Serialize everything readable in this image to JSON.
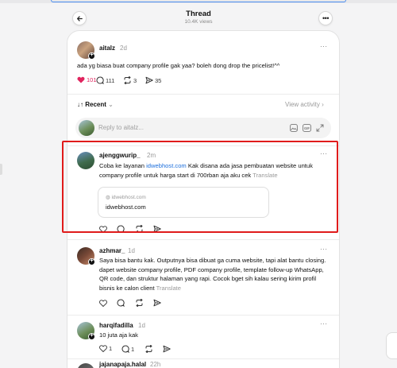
{
  "header": {
    "title": "Thread",
    "views": "10.4K views"
  },
  "original_post": {
    "username": "aitalz",
    "time": "2d",
    "text": "ada yg biasa buat company profile gak yaa? boleh dong drop the pricelist!^^",
    "likes": "101",
    "comments": "111",
    "reposts": "3",
    "shares": "35"
  },
  "sort": {
    "label": "Recent",
    "view_activity": "View activity"
  },
  "reply_box": {
    "placeholder": "Reply to aitalz..."
  },
  "replies": [
    {
      "username": "ajenggwurip_",
      "time": "2m",
      "text_before_link": "Coba ke layanan ",
      "link_text": "idwebhost.com",
      "text_after_link": " Kak disana ada jasa pembuatan website untuk company profile untuk harga start di 700rban aja aku cek",
      "translate": "Translate",
      "link_card": {
        "domain": "idwebhost.com",
        "title": "idwebhost.com"
      }
    },
    {
      "username": "azhmar_",
      "time": "1d",
      "text": "Saya bisa bantu kak. Outputnya bisa dibuat ga cuma website, tapi alat bantu closing. dapet website company profile, PDF company profile, template follow-up WhatsApp, QR code, dan struktur halaman yang rapi. Cocok bget sih kalau sering kirim profil bisnis ke calon client",
      "translate": "Translate"
    },
    {
      "username": "harqifadilla",
      "time": "1d",
      "text": "10 juta aja kak",
      "likes": "1",
      "comments": "1"
    },
    {
      "username": "jajanapaja.halal",
      "time": "22h"
    }
  ],
  "colors": {
    "highlight": "#e01b1b",
    "link": "#1d6fdc",
    "like": "#e0245e"
  }
}
